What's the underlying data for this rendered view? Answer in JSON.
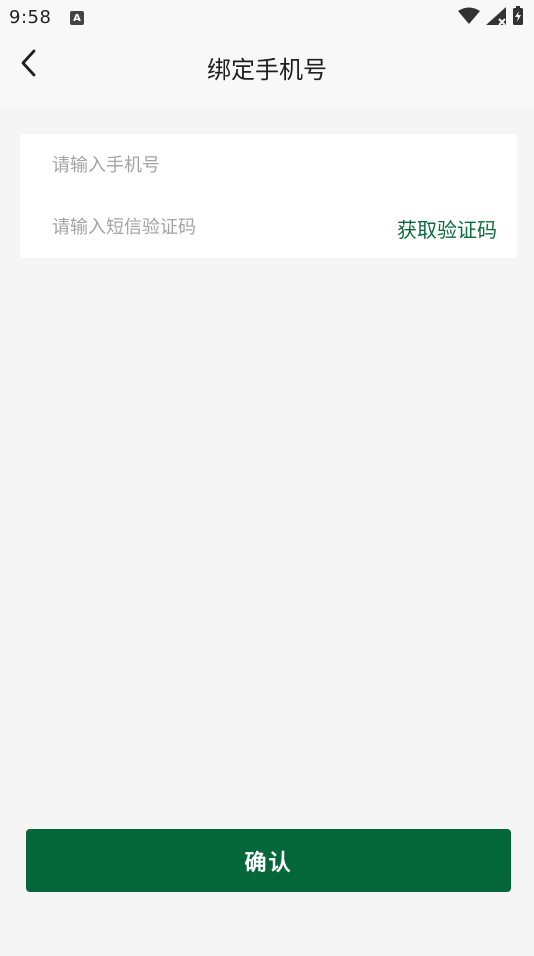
{
  "status_bar": {
    "time": "9:58",
    "notification_icon": "a-notification-icon",
    "notification_letter": "A",
    "wifi_icon": "wifi-icon",
    "signal_icon": "cellular-signal-icon",
    "battery_icon": "battery-charging-icon"
  },
  "header": {
    "back_icon": "chevron-left-icon",
    "title": "绑定手机号"
  },
  "form": {
    "phone_placeholder": "请输入手机号",
    "phone_value": "",
    "code_placeholder": "请输入短信验证码",
    "code_value": "",
    "get_code_label": "获取验证码"
  },
  "confirm_label": "确认",
  "colors": {
    "accent": "#03673a",
    "link": "#0c6b3c",
    "background": "#f5f5f5"
  }
}
